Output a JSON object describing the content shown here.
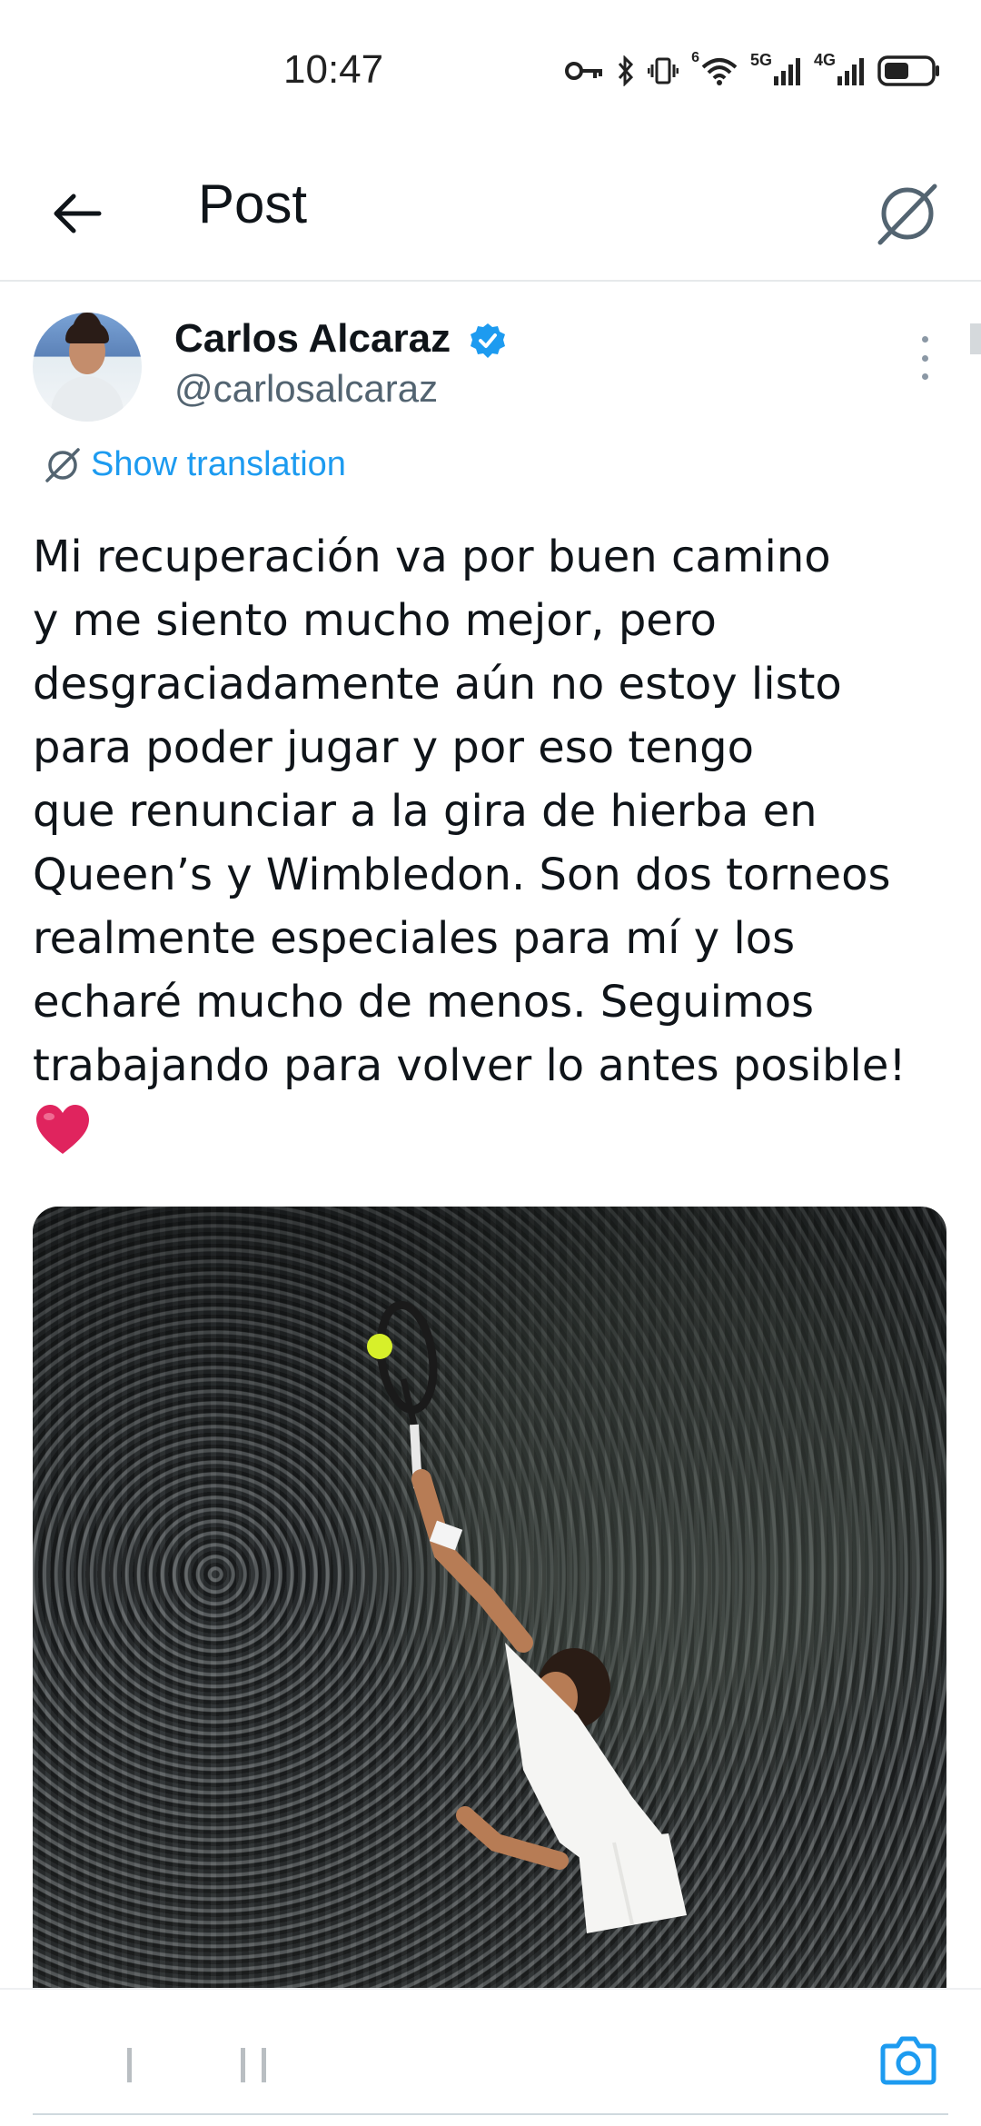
{
  "status_bar": {
    "time": "10:47",
    "signal_1_label": "5G",
    "signal_2_label": "4G",
    "wifi_label": "6"
  },
  "header": {
    "title": "Post"
  },
  "tweet": {
    "author": {
      "display_name": "Carlos Alcaraz",
      "handle": "@carlosalcaraz",
      "verified": true
    },
    "show_translation_label": "Show translation",
    "text": "Mi recuperación va por buen camino\ny me siento mucho mejor, pero\ndesgraciadamente aún no estoy listo\npara poder jugar y por eso tengo\nque renunciar a la gira de hierba en\nQueen’s y Wimbledon. Son dos torneos\nrealmente especiales para mí y los\necharé mucho de menos. Seguimos\ntrabajando para volver lo antes posible!",
    "emoji": "heart"
  },
  "colors": {
    "accent": "#1d9bf0",
    "verified": "#1d9bf0",
    "heart": "#e0245e"
  }
}
